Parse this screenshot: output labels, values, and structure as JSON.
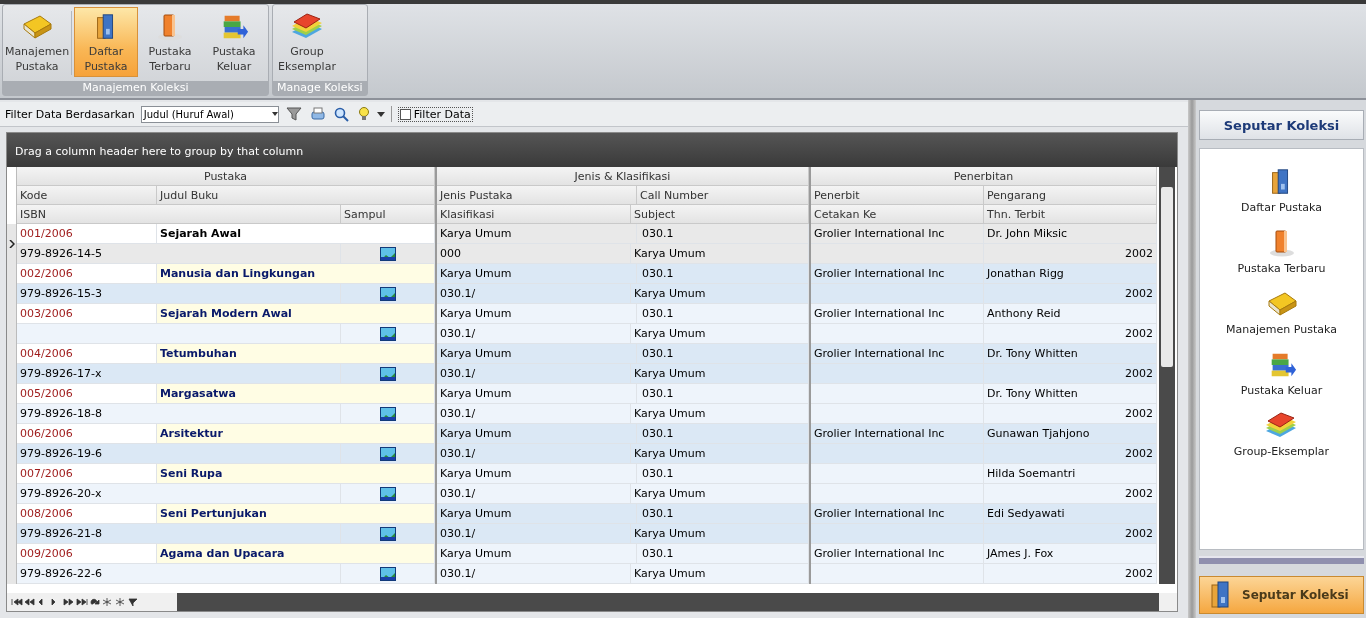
{
  "ribbon": {
    "groups": [
      {
        "label": "Manajemen Koleksi",
        "buttons": [
          {
            "label": "Manajemen Pustaka",
            "selected": false
          },
          {
            "label": "Daftar Pustaka",
            "selected": true
          },
          {
            "label": "Pustaka Terbaru",
            "selected": false
          },
          {
            "label": "Pustaka Keluar",
            "selected": false
          }
        ]
      },
      {
        "label": "Manage Koleksi",
        "buttons": [
          {
            "label": "Group Eksemplar",
            "selected": false
          }
        ]
      }
    ]
  },
  "filter_bar": {
    "label": "Filter Data Berdasarkan",
    "combo_value": "Judul (Huruf Awal)",
    "checkbox": {
      "label": "Filter Data",
      "checked": false
    }
  },
  "grid": {
    "group_panel_hint": "Drag a column header here to group by that column",
    "column_groups": [
      "Pustaka",
      "Jenis & Klasifikasi",
      "Penerbitan"
    ],
    "columns_line_1": [
      "Kode",
      "Judul Buku",
      "Jenis Pustaka",
      "Call Number",
      "Penerbit",
      "Pengarang"
    ],
    "columns_line_2": [
      "ISBN",
      "Sampul",
      "Klasifikasi",
      "Subject",
      "Cetakan Ke",
      "Thn. Terbit"
    ],
    "rows": [
      {
        "selected": true,
        "kode": "001/2006",
        "judul": "Sejarah Awal",
        "jenis": "Karya Umum",
        "call_number": "030.1",
        "penerbit": "Grolier International Inc",
        "pengarang": "Dr. John Miksic",
        "isbn": "979-8926-14-5",
        "klasifikasi": "000",
        "subject": "Karya Umum",
        "thn_terbit": "2002"
      },
      {
        "selected": false,
        "kode": "002/2006",
        "judul": "Manusia dan Lingkungan",
        "jenis": "Karya Umum",
        "call_number": "030.1",
        "penerbit": "Grolier International Inc",
        "pengarang": "Jonathan Rigg",
        "isbn": "979-8926-15-3",
        "klasifikasi": "030.1/",
        "subject": "Karya Umum",
        "thn_terbit": "2002"
      },
      {
        "selected": false,
        "kode": "003/2006",
        "judul": "Sejarah Modern Awal",
        "jenis": "Karya Umum",
        "call_number": "030.1",
        "penerbit": "Grolier International Inc",
        "pengarang": "Anthony Reid",
        "klasifikasi": "030.1/",
        "subject": "Karya Umum",
        "thn_terbit": "2002"
      },
      {
        "selected": false,
        "kode": "004/2006",
        "judul": "Tetumbuhan",
        "jenis": "Karya Umum",
        "call_number": "030.1",
        "penerbit": "Grolier International Inc",
        "pengarang": "Dr. Tony Whitten",
        "isbn": "979-8926-17-x",
        "klasifikasi": "030.1/",
        "subject": "Karya Umum",
        "thn_terbit": "2002"
      },
      {
        "selected": false,
        "kode": "005/2006",
        "judul": "Margasatwa",
        "jenis": "Karya Umum",
        "call_number": "030.1",
        "pengarang": "Dr. Tony Whitten",
        "isbn": "979-8926-18-8",
        "klasifikasi": "030.1/",
        "subject": "Karya Umum",
        "thn_terbit": "2002"
      },
      {
        "selected": false,
        "kode": "006/2006",
        "judul": "Arsitektur",
        "jenis": "Karya Umum",
        "call_number": "030.1",
        "penerbit": "Grolier International Inc",
        "pengarang": "Gunawan Tjahjono",
        "isbn": "979-8926-19-6",
        "klasifikasi": "030.1/",
        "subject": "Karya Umum",
        "thn_terbit": "2002"
      },
      {
        "selected": false,
        "kode": "007/2006",
        "judul": "Seni Rupa",
        "jenis": "Karya Umum",
        "call_number": "030.1",
        "pengarang": "Hilda Soemantri",
        "isbn": "979-8926-20-x",
        "klasifikasi": "030.1/",
        "subject": "Karya Umum",
        "thn_terbit": "2002"
      },
      {
        "selected": false,
        "kode": "008/2006",
        "judul": "Seni Pertunjukan",
        "jenis": "Karya Umum",
        "call_number": "030.1",
        "penerbit": "Grolier International Inc",
        "pengarang": "Edi Sedyawati",
        "isbn": "979-8926-21-8",
        "klasifikasi": "030.1/",
        "subject": "Karya Umum",
        "thn_terbit": "2002"
      },
      {
        "selected": false,
        "kode": "009/2006",
        "judul": "Agama dan Upacara",
        "jenis": "Karya Umum",
        "call_number": "030.1",
        "penerbit": "Grolier International Inc",
        "pengarang": "JAmes J. Fox",
        "isbn": "979-8926-22-6",
        "klasifikasi": "030.1/",
        "subject": "Karya Umum",
        "thn_terbit": "2002"
      }
    ]
  },
  "side_panel": {
    "title": "Seputar Koleksi",
    "items": [
      "Daftar Pustaka",
      "Pustaka Terbaru",
      "Manajemen Pustaka",
      "Pustaka Keluar",
      "Group-Eksemplar"
    ],
    "footer_button": "Seputar Koleksi"
  }
}
